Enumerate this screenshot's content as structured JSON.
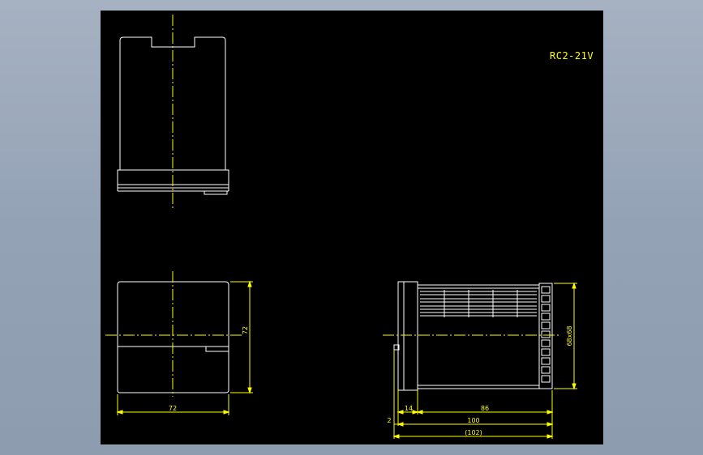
{
  "drawing": {
    "model_label": "RC2-21V",
    "dimensions": {
      "front_width": "72",
      "front_height": "72",
      "side_bezel": "14",
      "side_body": "86",
      "side_total": "100",
      "side_overall": "(102)",
      "side_offset": "2",
      "side_cutout": "68x68"
    },
    "colors": {
      "background": "#000000",
      "outline": "#ffffff",
      "dimension": "#ffff00",
      "centerline": "#ffff00",
      "frame": "#a6b2c2"
    }
  }
}
